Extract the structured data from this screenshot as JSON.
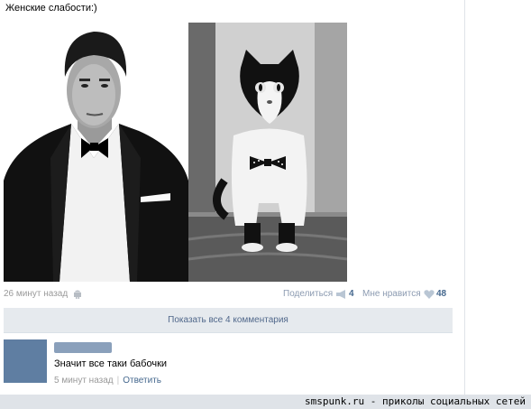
{
  "post": {
    "text": "Женские слабости:)",
    "photos": [
      {
        "name": "man-in-tuxedo-photo"
      },
      {
        "name": "cat-in-bowtie-photo"
      }
    ],
    "time": "26 минут назад",
    "platform_icon": "android-icon",
    "share_label": "Поделиться",
    "share_icon": "megaphone-icon",
    "share_count": "4",
    "like_label": "Мне нравится",
    "like_icon": "heart-icon",
    "like_count": "48"
  },
  "comments_toggle": {
    "label": "Показать все 4 комментария"
  },
  "comment": {
    "author": "",
    "text": "Значит все таки бабочки",
    "time": "5 минут назад",
    "reply_label": "Ответить"
  },
  "watermark": "smspunk.ru - приколы социальных сетей",
  "colors": {
    "link": "#45688e",
    "muted": "#999999",
    "button_bg": "#e6eaee",
    "avatar": "#5f7ea2",
    "watermark_bar": "#dfe3e8"
  }
}
